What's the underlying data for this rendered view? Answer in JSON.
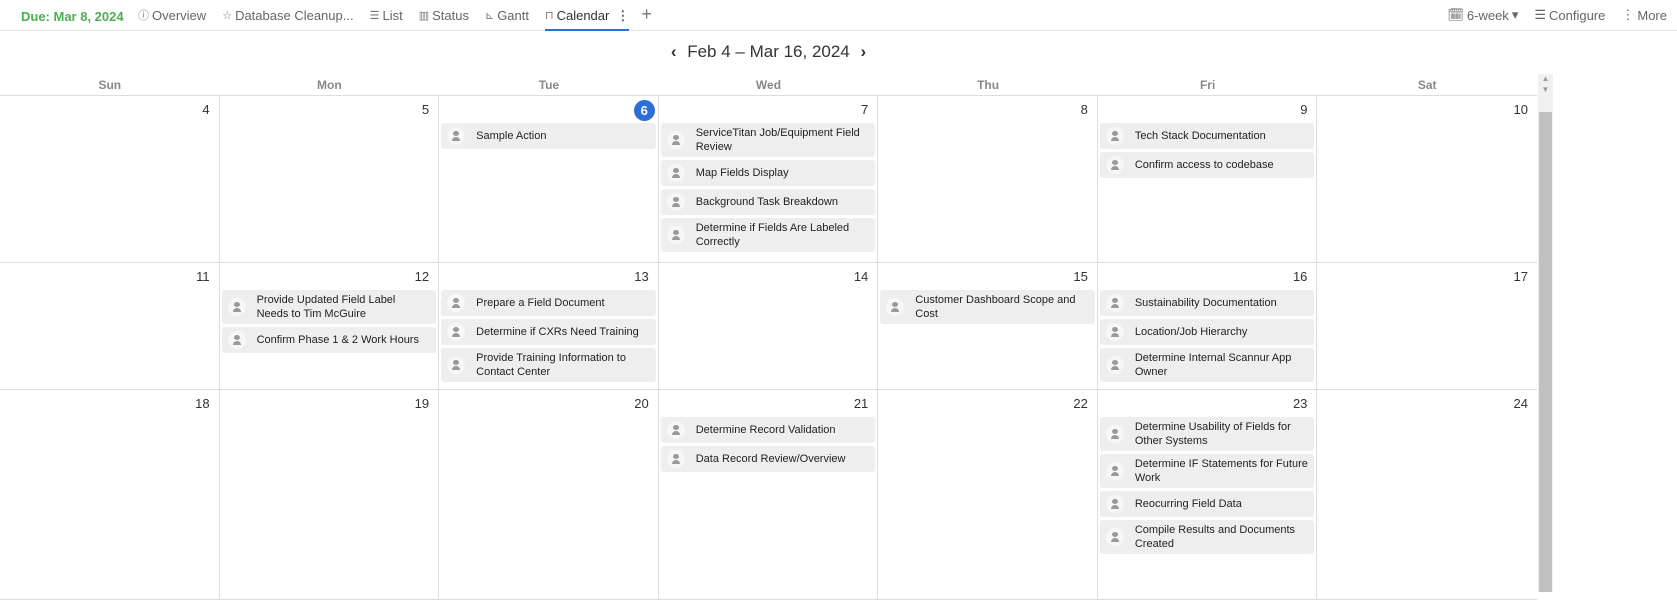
{
  "header": {
    "due": "Due: Mar 8, 2024",
    "tabs": [
      {
        "icon": "ⓘ",
        "label": "Overview"
      },
      {
        "icon": "☆",
        "label": "Database Cleanup..."
      },
      {
        "icon": "☰",
        "label": "List"
      },
      {
        "icon": "▥",
        "label": "Status"
      },
      {
        "icon": "⊾",
        "label": "Gantt"
      },
      {
        "icon": "⊓",
        "label": "Calendar"
      }
    ],
    "active_tab": "Calendar",
    "view": "6-week",
    "configure": "Configure",
    "more": "More"
  },
  "calendar": {
    "range": "Feb 4 – Mar 16, 2024",
    "today": "6",
    "days": [
      "Sun",
      "Mon",
      "Tue",
      "Wed",
      "Thu",
      "Fri",
      "Sat"
    ],
    "weeks": [
      [
        {
          "d": "4",
          "e": []
        },
        {
          "d": "5",
          "e": []
        },
        {
          "d": "6",
          "e": [
            "Sample Action"
          ]
        },
        {
          "d": "7",
          "e": [
            "ServiceTitan Job/Equipment Field Review",
            "Map Fields Display",
            "Background Task Breakdown",
            "Determine if Fields Are Labeled Correctly"
          ]
        },
        {
          "d": "8",
          "e": []
        },
        {
          "d": "9",
          "e": [
            "Tech Stack Documentation",
            "Confirm access to codebase"
          ]
        },
        {
          "d": "10",
          "e": []
        }
      ],
      [
        {
          "d": "11",
          "e": []
        },
        {
          "d": "12",
          "e": [
            "Provide Updated Field Label Needs to Tim McGuire",
            "Confirm Phase 1 & 2 Work Hours"
          ]
        },
        {
          "d": "13",
          "e": [
            "Prepare a Field Document",
            "Determine if CXRs Need Training",
            "Provide Training Information to Contact Center"
          ]
        },
        {
          "d": "14",
          "e": []
        },
        {
          "d": "15",
          "e": [
            "Customer Dashboard Scope and Cost"
          ]
        },
        {
          "d": "16",
          "e": [
            "Sustainability Documentation",
            "Location/Job Hierarchy",
            "Determine Internal Scannur App Owner"
          ]
        },
        {
          "d": "17",
          "e": []
        }
      ],
      [
        {
          "d": "18",
          "e": []
        },
        {
          "d": "19",
          "e": []
        },
        {
          "d": "20",
          "e": []
        },
        {
          "d": "21",
          "e": [
            "Determine Record Validation",
            "Data Record Review/Overview"
          ]
        },
        {
          "d": "22",
          "e": []
        },
        {
          "d": "23",
          "e": [
            "Determine Usability of Fields for Other Systems",
            "Determine IF Statements for Future Work",
            "Reocurring Field Data",
            "Compile Results and Documents Created"
          ]
        },
        {
          "d": "24",
          "e": []
        }
      ]
    ]
  }
}
